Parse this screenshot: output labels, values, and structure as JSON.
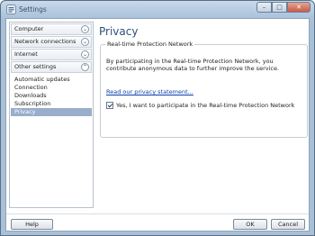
{
  "window": {
    "title": "Settings",
    "minimize_glyph": "–",
    "maximize_glyph": "□",
    "close_glyph": "✕"
  },
  "sidebar": {
    "categories": [
      {
        "label": "Computer",
        "expanded": false
      },
      {
        "label": "Network connections",
        "expanded": false
      },
      {
        "label": "Internet",
        "expanded": false
      },
      {
        "label": "Other settings",
        "expanded": true
      }
    ],
    "chevron_collapsed": "⌄",
    "chevron_expanded": "⌃",
    "sub_items": [
      {
        "label": "Automatic updates",
        "selected": false
      },
      {
        "label": "Connection",
        "selected": false
      },
      {
        "label": "Downloads",
        "selected": false
      },
      {
        "label": "Subscription",
        "selected": false
      },
      {
        "label": "Privacy",
        "selected": true
      }
    ]
  },
  "main": {
    "page_title": "Privacy",
    "group": {
      "title": "Real-time Protection Network",
      "description": "By participating in the Real-time Protection Network, you contribute anonymous data to further improve the service.",
      "link_text": "Read our privacy statement...",
      "checkbox_label": "Yes, I want to participate in the Real-time Protection Network",
      "checkbox_checked": true
    }
  },
  "footer": {
    "help_label": "Help",
    "ok_label": "OK",
    "cancel_label": "Cancel"
  },
  "colors": {
    "title_blue": "#2d4f7c",
    "link_blue": "#0a3fa8",
    "selection": "#98aecb"
  }
}
